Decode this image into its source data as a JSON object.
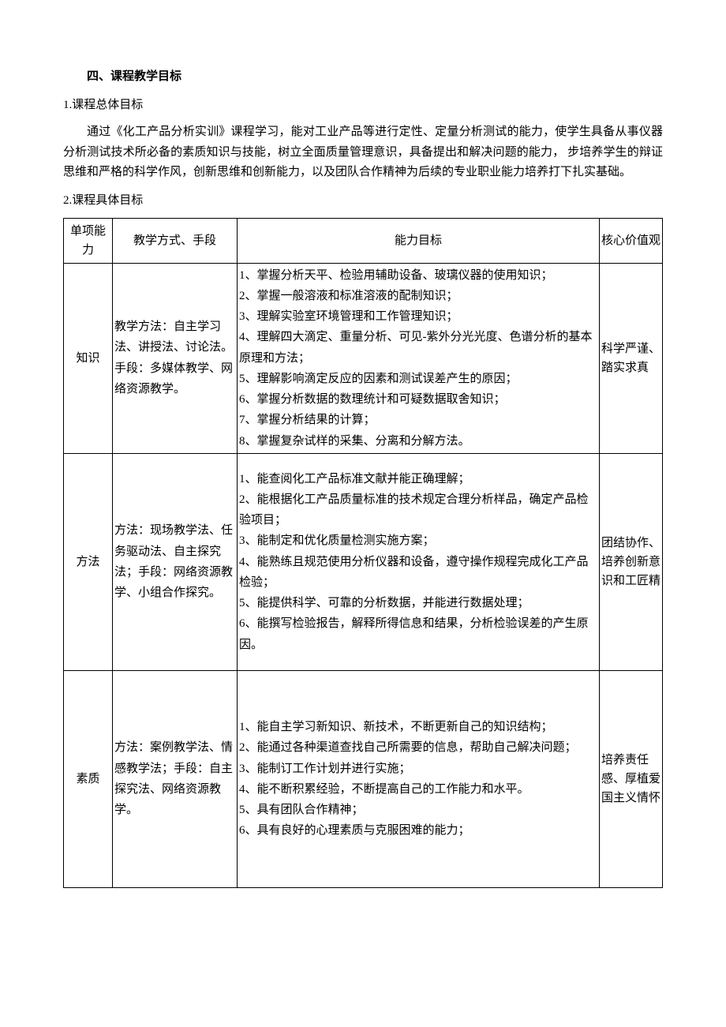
{
  "section_heading": "四、课程教学目标",
  "sub1": {
    "num": "1.",
    "title": "课程总体目标"
  },
  "overall_paragraph": "通过《化工产品分析实训》课程学习，能对工业产品等进行定性、定量分析测试的能力，使学生具备从事仪器分析测试技术所必备的素质知识与技能，树立全面质量管理意识，具备提出和解决问题的能力， 步培养学生的辩证思维和严格的科学作风，创新思维和创新能力，以及团队合作精神为后续的专业职业能力培养打下扎实基础。",
  "sub2": {
    "num": "2.",
    "title": "课程具体目标"
  },
  "headers": {
    "col1": "单项能力",
    "col2": "教学方式、手段",
    "col3": "能力目标",
    "col4": "核心价值观"
  },
  "rows": [
    {
      "category": "知识",
      "method": "教学方法：自主学习法、讲授法、讨论法。手段：多媒体教学、网络资源教学。",
      "goals": [
        "1、掌握分析天平、检验用辅助设备、玻璃仪器的使用知识；",
        "2、掌握一般溶液和标准溶液的配制知识；",
        "3、理解实验室环境管理和工作管理知识；",
        "4、理解四大滴定、重量分析、可见-紫外分光光度、色谱分析的基本原理和方法；",
        "5、理解影响滴定反应的因素和测试误差产生的原因；",
        "6、掌握分析数据的数理统计和可疑数据取舍知识；",
        "7、掌握分析结果的计算；",
        "8、掌握复杂试样的采集、分离和分解方法。"
      ],
      "value": "科学严谨、踏实求真"
    },
    {
      "category": "方法",
      "method": "方法：现场教学法、任务驱动法、自主探究法；手段：网络资源教学、小组合作探究。",
      "goals": [
        "1、能查阅化工产品标准文献并能正确理解；",
        "2、能根据化工产品质量标准的技术规定合理分析样品，确定产品检验项目；",
        "3、能制定和优化质量检测实施方案；",
        "4、能熟练且规范使用分析仪器和设备，遵守操作规程完成化工产品检验；",
        "5、能提供科学、可靠的分析数据，并能进行数据处理；",
        "6、能撰写检验报告，解释所得信息和结果，分析检验误差的产生原因。"
      ],
      "value": "团结协作、培养创新意识和工匠精"
    },
    {
      "category": "素质",
      "method": "方法：案例教学法、情感教学法；手段：自主探究法、网络资源教学。",
      "goals": [
        "1、能自主学习新知识、新技术，不断更新自己的知识结构；",
        "2、能通过各种渠道查找自己所需要的信息，帮助自己解决问题；",
        "3、能制订工作计划并进行实施；",
        "4、能不断积累经验，不断提高自己的工作能力和水平。",
        "5、具有团队合作精神；",
        "6、具有良好的心理素质与克服困难的能力；"
      ],
      "value": "培养责任感、厚植爱国主义情怀"
    }
  ]
}
